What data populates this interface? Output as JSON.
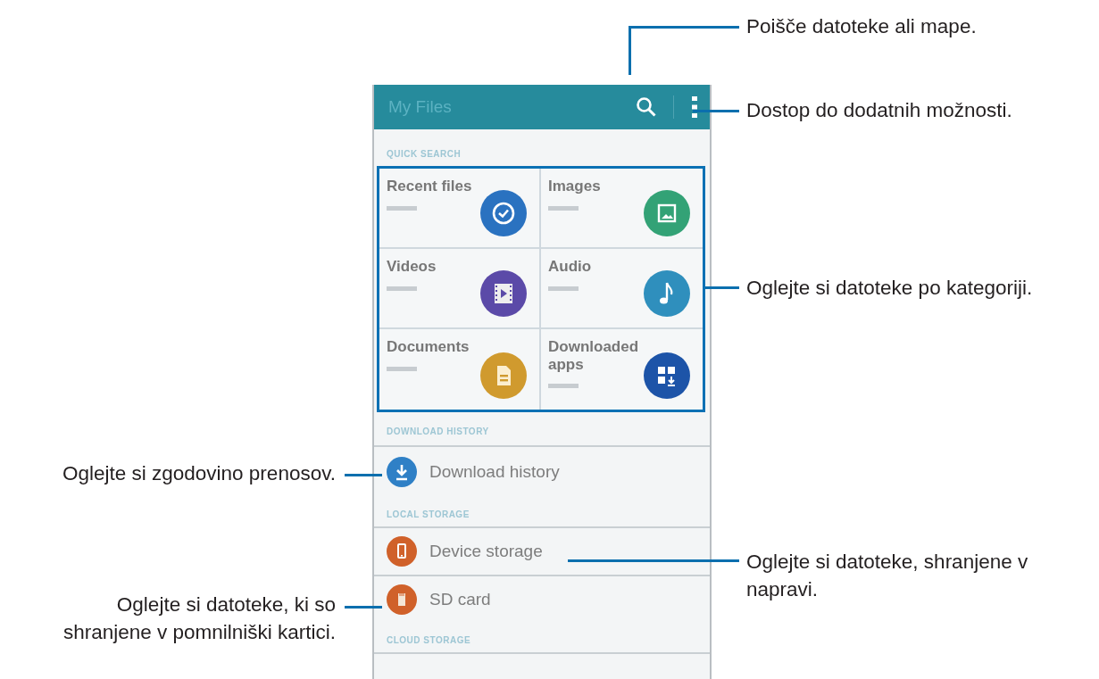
{
  "app_bar": {
    "title": "My Files"
  },
  "sections": [
    {
      "header": "QUICK SEARCH",
      "kind": "grid",
      "items": [
        {
          "label": "Recent files",
          "color": "#2a72c0"
        },
        {
          "label": "Images",
          "color": "#33a276"
        },
        {
          "label": "Videos",
          "color": "#5b4aa8"
        },
        {
          "label": "Audio",
          "color": "#2f8fbd"
        },
        {
          "label": "Documents",
          "color": "#d09a2e"
        },
        {
          "label": "Downloaded apps",
          "color": "#1d54a8"
        }
      ]
    },
    {
      "header": "DOWNLOAD HISTORY",
      "kind": "list",
      "items": [
        {
          "label": "Download history",
          "color": "#2f80c6"
        }
      ]
    },
    {
      "header": "LOCAL STORAGE",
      "kind": "list",
      "items": [
        {
          "label": "Device storage",
          "color": "#d0612a"
        },
        {
          "label": "SD card",
          "color": "#d0612a"
        }
      ]
    },
    {
      "header": "CLOUD STORAGE",
      "kind": "list"
    }
  ],
  "callouts": [
    {
      "lines": [
        "Poišče datoteke ali mape."
      ]
    },
    {
      "lines": [
        "Dostop do dodatnih možnosti."
      ]
    },
    {
      "lines": [
        "Oglejte si datoteke po kategoriji."
      ]
    },
    {
      "lines": [
        "Oglejte si zgodovino prenosov."
      ]
    },
    {
      "lines": [
        "Oglejte si datoteke, shranjene v",
        "napravi."
      ]
    },
    {
      "lines": [
        "Oglejte si datoteke, ki so",
        "shranjene v pomnilniški kartici."
      ]
    }
  ]
}
